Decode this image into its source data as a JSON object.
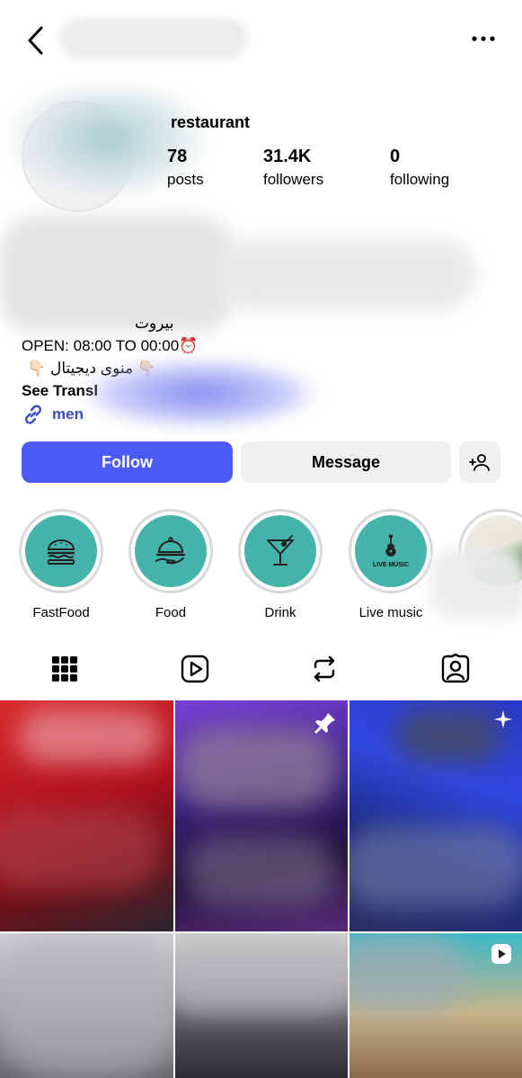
{
  "header": {
    "back_icon": "chevron-left-icon",
    "more_icon": "more-horizontal-icon"
  },
  "profile": {
    "display_name": "restaurant",
    "stats": [
      {
        "value": "78",
        "label": "posts"
      },
      {
        "value": "31.4K",
        "label": "followers"
      },
      {
        "value": "0",
        "label": "following"
      }
    ]
  },
  "bio": {
    "line_rtl_1": "بيروت",
    "hours": "OPEN: 08:00 TO 00:00⏰",
    "menu_line": "👇🏻 منوى ديجيتال 👇🏻",
    "see_translation": "See Transl",
    "link_text": "men"
  },
  "actions": {
    "follow": "Follow",
    "message": "Message",
    "add_user_icon": "add-user-icon"
  },
  "highlights": [
    {
      "label": "FastFood",
      "icon": "burger-icon"
    },
    {
      "label": "Food",
      "icon": "cloche-icon"
    },
    {
      "label": "Drink",
      "icon": "cocktail-icon"
    },
    {
      "label": "Live music",
      "icon": "guitar-icon",
      "badge": "LIVE MUSIC"
    },
    {
      "label": "",
      "icon": "photo-thumbnail"
    }
  ],
  "tabs": [
    {
      "name": "grid",
      "icon": "grid-icon",
      "active": true
    },
    {
      "name": "reels",
      "icon": "reels-icon",
      "active": false
    },
    {
      "name": "reposts",
      "icon": "repost-icon",
      "active": false
    },
    {
      "name": "tagged",
      "icon": "tagged-icon",
      "active": false
    }
  ],
  "colors": {
    "accent": "#4a5cf5",
    "highlight_fill": "#46b3aa",
    "link": "#3b4cc0",
    "button_gray": "#efeff2"
  }
}
